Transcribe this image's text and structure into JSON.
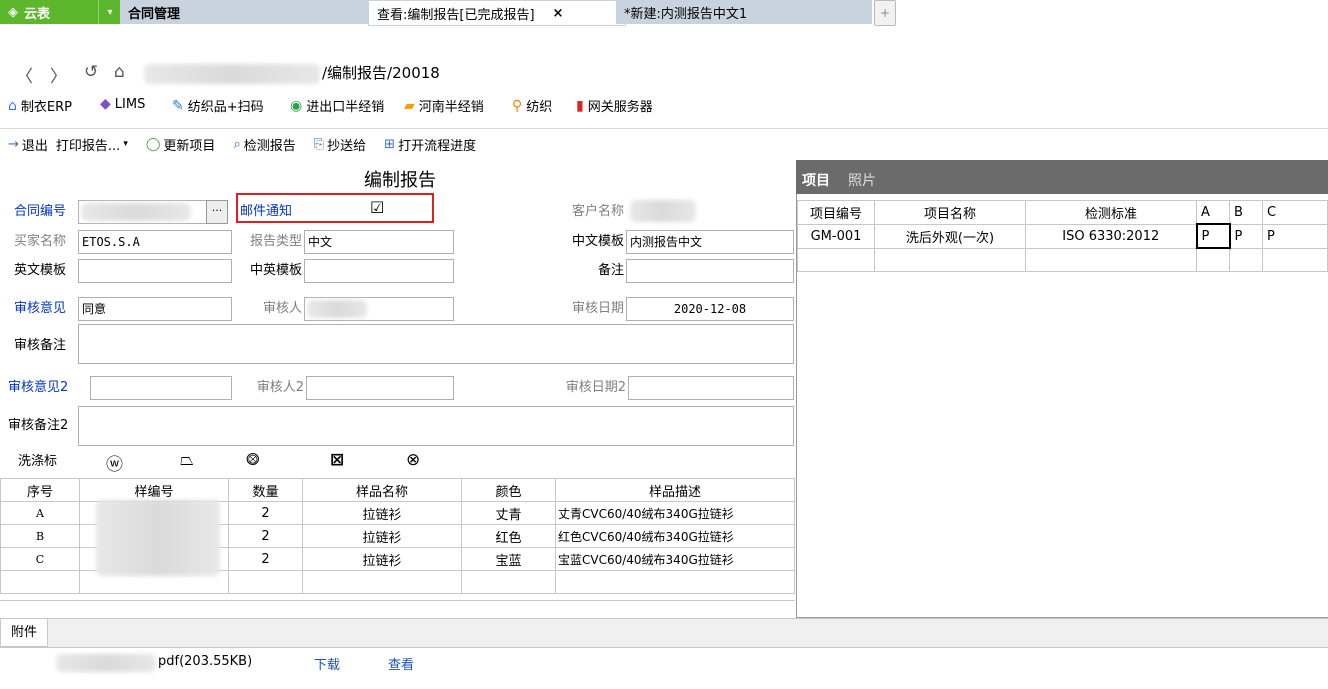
{
  "tabs": {
    "logo": "云表",
    "contract": "合同管理",
    "view_report": "查看:编制报告[已完成报告]",
    "close": "×",
    "new_report": "*新建:内测报告中文1",
    "add": "+"
  },
  "address": {
    "path": "/编制报告/20018"
  },
  "bookmarks": [
    "制衣ERP",
    "LIMS",
    "纺织品+扫码",
    "进出口半经销",
    "河南半经销",
    "纺织",
    "网关服务器"
  ],
  "toolbar": {
    "exit": "退出",
    "print": "打印报告...",
    "refresh": "更新项目",
    "check_report": "检测报告",
    "cc": "抄送给",
    "open_flow": "打开流程进度"
  },
  "form": {
    "title": "编制报告",
    "contract_no_label": "合同编号",
    "contract_no_btn": "···",
    "email_notice_label": "邮件通知",
    "email_checkbox": "☑",
    "customer_label": "客户名称",
    "buyer_label": "买家名称",
    "buyer_value": "ETOS.S.A",
    "report_type_label": "报告类型",
    "report_type_value": "中文",
    "cn_template_label": "中文模板",
    "cn_template_value": "内测报告中文",
    "en_template_label": "英文模板",
    "cn_en_template_label": "中英模板",
    "remark_label": "备注",
    "review_opinion_label": "审核意见",
    "review_opinion_value": "同意",
    "reviewer_label": "审核人",
    "review_date_label": "审核日期",
    "review_date_value": "2020-12-08",
    "review_remark_label": "审核备注",
    "review_opinion2_label": "审核意见2",
    "reviewer2_label": "审核人2",
    "review_date2_label": "审核日期2",
    "review_remark2_label": "审核备注2",
    "wash_label": "洗涤标",
    "wash_symbols": [
      "ⓦ",
      "⏢",
      "⨷",
      "⊠",
      "⊗"
    ]
  },
  "samples": {
    "headers": [
      "序号",
      "样编号",
      "数量",
      "样品名称",
      "颜色",
      "样品描述"
    ],
    "rows": [
      [
        "A",
        "",
        "2",
        "拉链衫",
        "丈青",
        "丈青CVC60/40绒布340G拉链衫"
      ],
      [
        "B",
        "",
        "2",
        "拉链衫",
        "红色",
        "红色CVC60/40绒布340G拉链衫"
      ],
      [
        "C",
        "",
        "2",
        "拉链衫",
        "宝蓝",
        "宝蓝CVC60/40绒布340G拉链衫"
      ]
    ]
  },
  "right_panel": {
    "tab_items": "项目",
    "tab_photos": "照片",
    "headers": [
      "项目编号",
      "项目名称",
      "检测标准",
      "A",
      "B",
      "C"
    ],
    "rows": [
      [
        "GM-001",
        "洗后外观(一次)",
        "ISO 6330:2012",
        "P",
        "P",
        "P"
      ]
    ]
  },
  "attachments": {
    "tab": "附件",
    "file": "pdf(203.55KB)",
    "download": "下载",
    "view": "查看"
  },
  "colors": {
    "brand": "#5cb72d",
    "label_blue": "#0033cc",
    "highlight_red": "#e02020"
  }
}
